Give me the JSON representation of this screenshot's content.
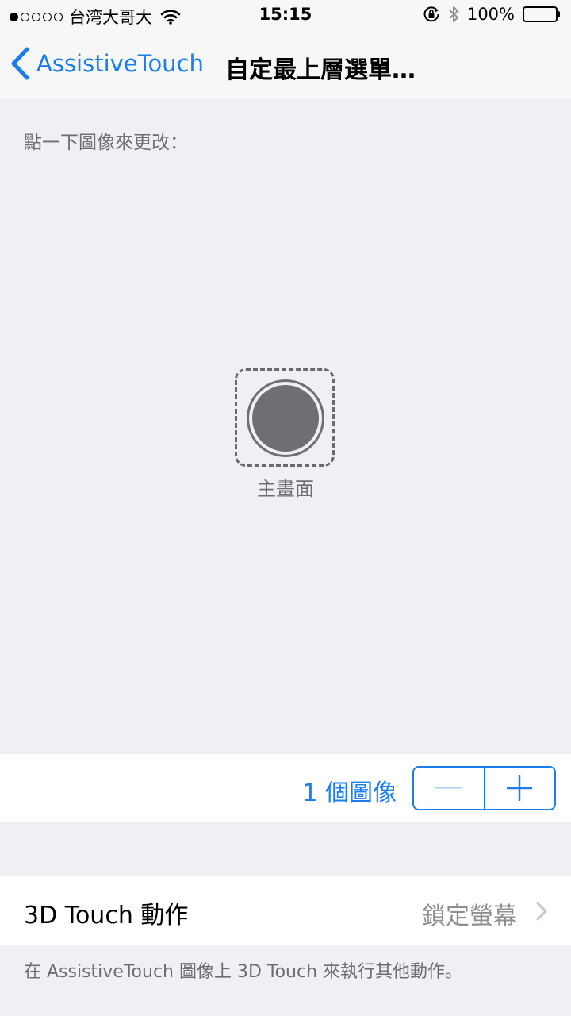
{
  "status_bar": {
    "carrier": "台湾大哥大",
    "time": "15:15",
    "battery": "100%",
    "signal_bars": 1
  },
  "nav": {
    "back_label": "AssistiveTouch",
    "title": "自定最上層選單…"
  },
  "content": {
    "hint": "點一下圖像來更改：",
    "home_label": "主畫面",
    "icon_count_label": "1 個圖像"
  },
  "touch_row": {
    "label": "3D Touch 動作",
    "value": "鎖定螢幕"
  },
  "footer_note": "在 AssistiveTouch 圖像上 3D Touch 來執行其他動作。",
  "colors": {
    "accent": "#1a7ef2",
    "background": "#efeff4",
    "secondary_text": "#6d6d72"
  },
  "icons": [
    "signal-dots",
    "wifi-icon",
    "orientation-lock-icon",
    "bluetooth-icon",
    "battery-icon",
    "back-chevron-icon",
    "minus-icon",
    "plus-icon",
    "chevron-right-icon"
  ]
}
